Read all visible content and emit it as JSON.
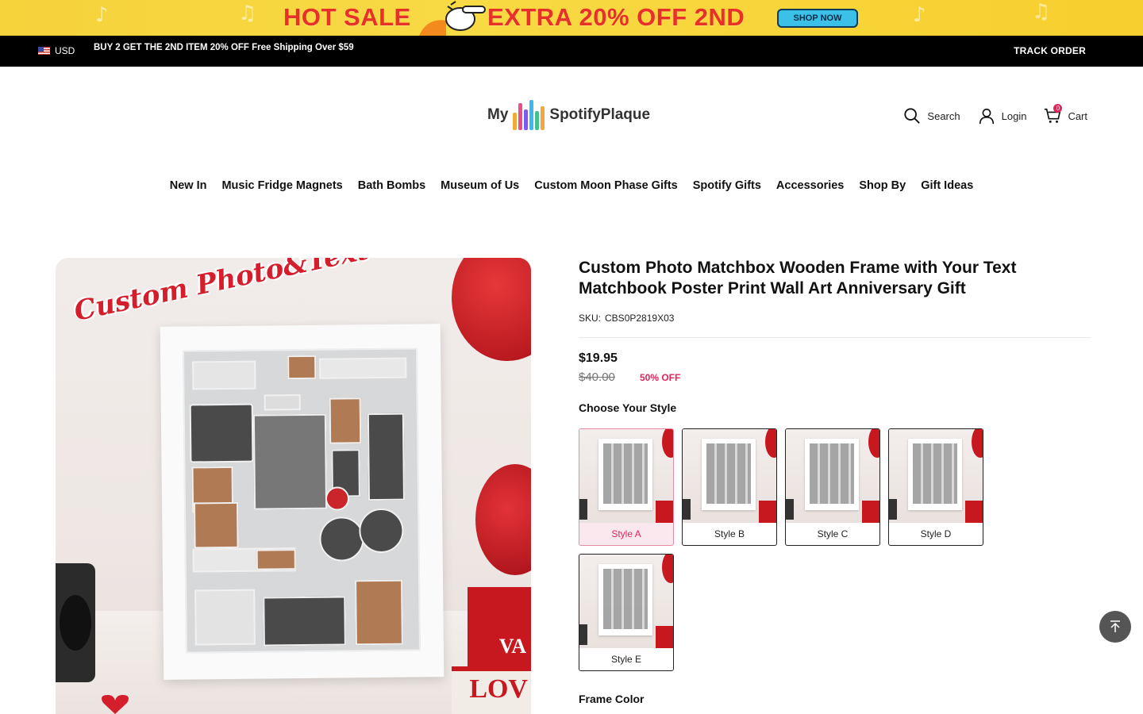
{
  "promo": {
    "left_text": "HOT SALE",
    "right_text": "EXTRA 20% OFF 2ND",
    "button": "SHOP NOW"
  },
  "topbar": {
    "currency": "USD",
    "announcement": "BUY 2 GET THE 2ND ITEM 20% OFF Free Shipping Over $59",
    "track_order": "TRACK ORDER"
  },
  "header": {
    "logo_my": "My",
    "logo_name": "SpotifyPlaque",
    "search": "Search",
    "login": "Login",
    "cart": "Cart",
    "cart_count": "0"
  },
  "nav": [
    "New In",
    "Music Fridge Magnets",
    "Bath Bombs",
    "Museum of Us",
    "Custom Moon Phase Gifts",
    "Spotify Gifts",
    "Accessories",
    "Shop By",
    "Gift Ideas"
  ],
  "gallery": {
    "overlay_text": "Custom Photo&Text",
    "book_text_1": "VA",
    "book_text_2": "LOV"
  },
  "product": {
    "title": "Custom Photo Matchbox Wooden Frame with Your Text Matchbook Poster Print Wall Art Anniversary Gift",
    "sku_label": "SKU:",
    "sku_value": "CBS0P2819X03",
    "price": "$19.95",
    "old_price": "$40.00",
    "discount": "50% OFF",
    "style_label": "Choose Your Style",
    "styles": [
      {
        "name": "Style A",
        "selected": true
      },
      {
        "name": "Style B",
        "selected": false
      },
      {
        "name": "Style C",
        "selected": false
      },
      {
        "name": "Style D",
        "selected": false
      },
      {
        "name": "Style E",
        "selected": false
      }
    ],
    "frame_color_label": "Frame Color"
  },
  "colors": {
    "accent": "#e0255b",
    "promo_bg": "#f6d23b",
    "promo_text": "#e8302b",
    "topbar_bg": "#000000"
  }
}
